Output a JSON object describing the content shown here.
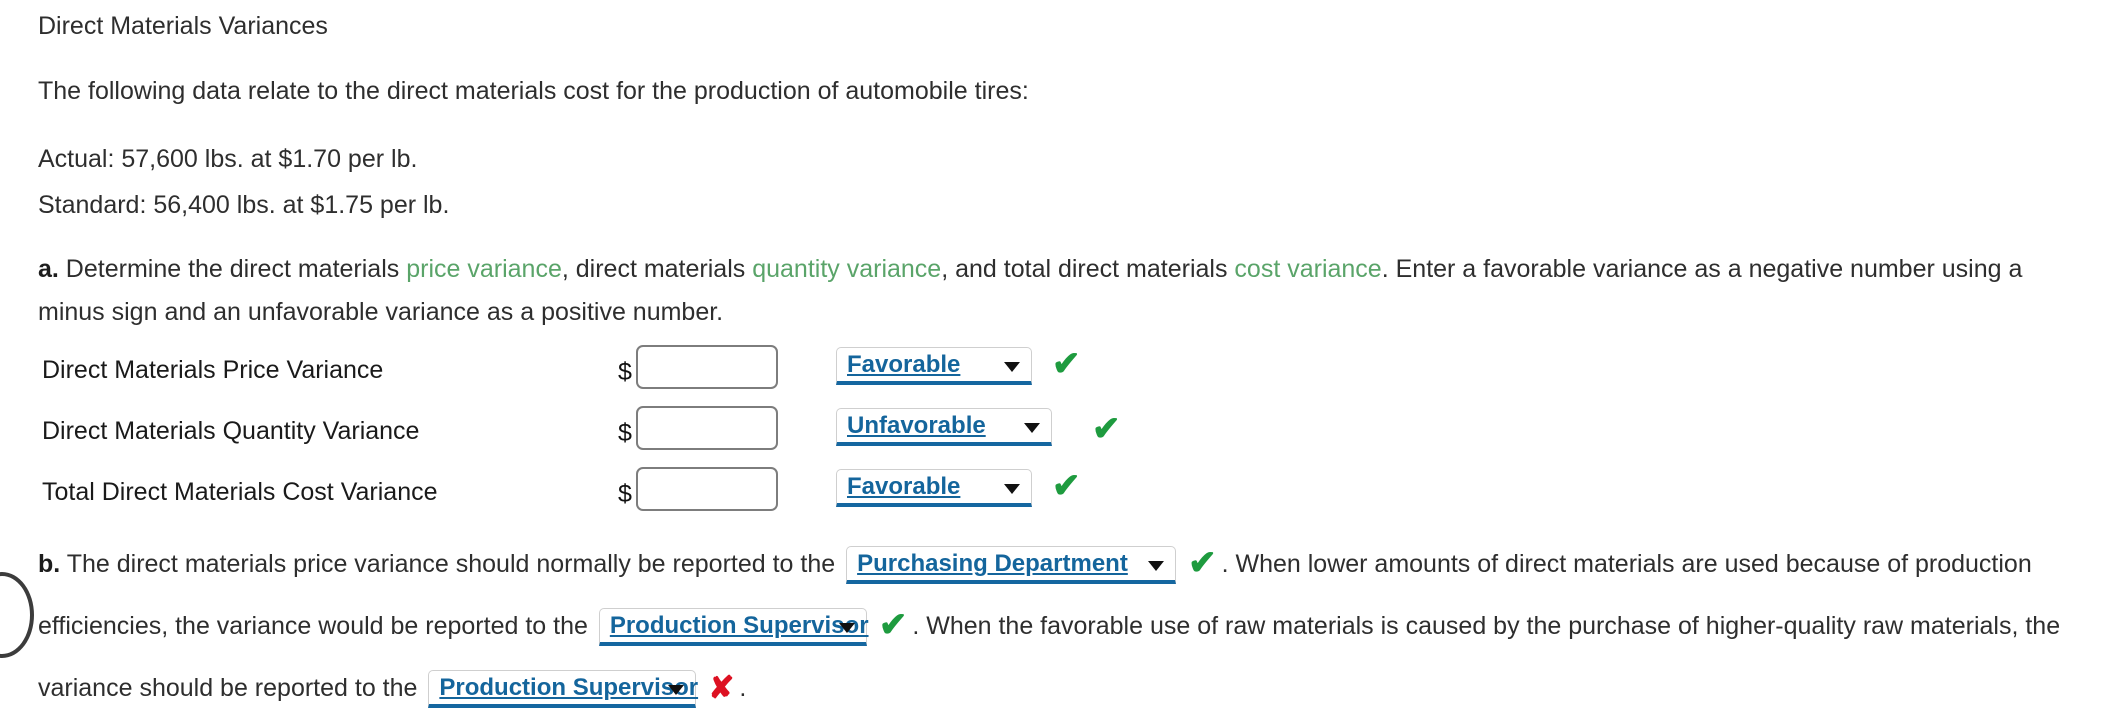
{
  "title": "Direct Materials Variances",
  "intro": "The following data relate to the direct materials cost for the production of automobile tires:",
  "data_lines": {
    "actual": "Actual: 57,600 lbs. at $1.70 per lb.",
    "standard": "Standard: 56,400 lbs. at $1.75 per lb."
  },
  "part_a": {
    "marker": "a.",
    "text_1": " Determine the direct materials ",
    "term_1": "price variance",
    "text_2": ", direct materials ",
    "term_2": "quantity variance",
    "text_3": ", and total direct materials ",
    "term_3": "cost variance",
    "text_4": ". Enter a favorable variance as a negative number using a minus sign and an unfavorable variance as a positive number."
  },
  "variance_rows": [
    {
      "label": "Direct Materials Price Variance",
      "currency": "$",
      "amount": "",
      "placeholder": "",
      "dropdown_value": "Favorable",
      "mark": "✔",
      "mark_type": "check"
    },
    {
      "label": "Direct Materials Quantity Variance",
      "currency": "$",
      "amount": "",
      "placeholder": "",
      "dropdown_value": "Unfavorable",
      "mark": "✔",
      "mark_type": "check"
    },
    {
      "label": "Total Direct Materials Cost Variance",
      "currency": "$",
      "amount": "",
      "placeholder": "",
      "dropdown_value": "Favorable",
      "mark": "✔",
      "mark_type": "check"
    }
  ],
  "dropdown_options": [
    "Favorable",
    "Unfavorable",
    "Purchasing Department",
    "Production Supervisor"
  ],
  "part_b": {
    "marker": "b.",
    "text_1": " The direct materials price variance should normally be reported to the ",
    "dropdown_1": "Purchasing Department",
    "mark_1": "✔",
    "text_2": ". When lower amounts of direct materials are used because of production efficiencies, the variance would be reported to the ",
    "dropdown_2": "Production Supervisor",
    "mark_2": "✔",
    "text_3": ". When the favorable use of raw materials is caused by the purchase of higher-quality raw materials, the variance should be reported to the ",
    "dropdown_3": "Production Supervisor",
    "mark_3": "✘",
    "text_4": "."
  },
  "colors": {
    "term_green": "#5aa469",
    "dropdown_blue": "#14659c",
    "check_green": "#1e9b3f",
    "cross_red": "#dd1122",
    "body_text": "#2e2e2e"
  }
}
